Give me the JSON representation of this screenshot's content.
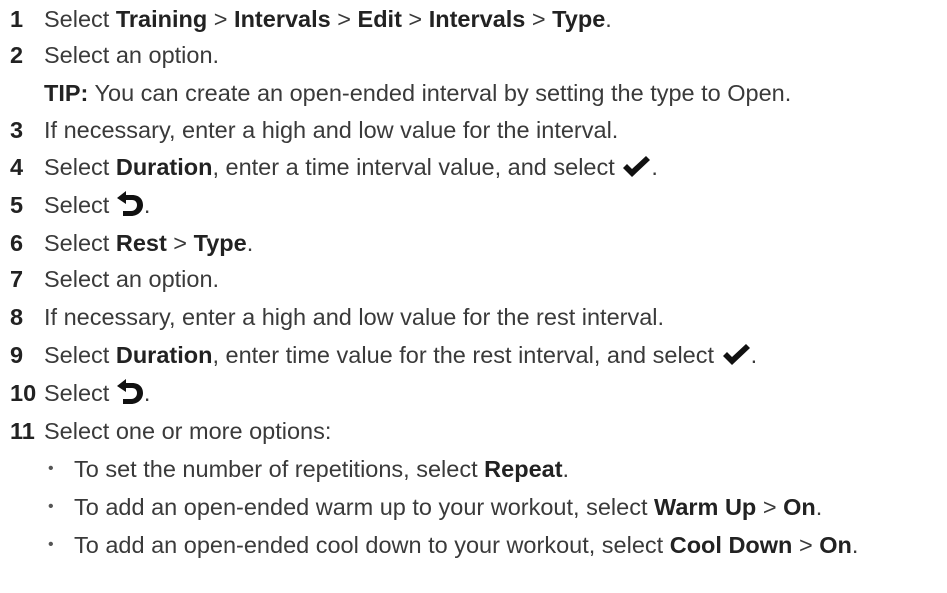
{
  "steps": [
    {
      "num": "1",
      "parts": [
        "Select ",
        "Training",
        " > ",
        "Intervals",
        " > ",
        "Edit",
        " > ",
        "Intervals",
        " > ",
        "Type",
        "."
      ]
    },
    {
      "num": "2",
      "text": "Select an option.",
      "tip": {
        "label": "TIP:",
        "text": " You can create an open-ended interval by setting the type to Open."
      }
    },
    {
      "num": "3",
      "text": "If necessary, enter a high and low value for the interval."
    },
    {
      "num": "4",
      "parts": [
        "Select ",
        "Duration",
        ", enter a time interval value, and select "
      ],
      "icon": "checkmark-icon",
      "after": "."
    },
    {
      "num": "5",
      "pre": "Select ",
      "icon": "back-arrow-icon",
      "after": "."
    },
    {
      "num": "6",
      "parts": [
        "Select ",
        "Rest",
        " > ",
        "Type",
        "."
      ]
    },
    {
      "num": "7",
      "text": "Select an option."
    },
    {
      "num": "8",
      "text": "If necessary, enter a high and low value for the rest interval."
    },
    {
      "num": "9",
      "parts": [
        "Select ",
        "Duration",
        ", enter time value for the rest interval, and select "
      ],
      "icon": "checkmark-icon",
      "after": "."
    },
    {
      "num": "10",
      "pre": "Select ",
      "icon": "back-arrow-icon",
      "after": "."
    },
    {
      "num": "11",
      "text": "Select one or more options:"
    }
  ],
  "bullets": [
    {
      "parts": [
        "To set the number of repetitions, select ",
        "Repeat",
        "."
      ]
    },
    {
      "parts": [
        "To add an open-ended warm up to your workout, select ",
        "Warm Up",
        " > ",
        "On",
        "."
      ]
    },
    {
      "parts": [
        "To add an open-ended cool down to your workout, select ",
        "Cool Down",
        " > ",
        "On",
        "."
      ]
    }
  ],
  "bullet_glyph": "•"
}
